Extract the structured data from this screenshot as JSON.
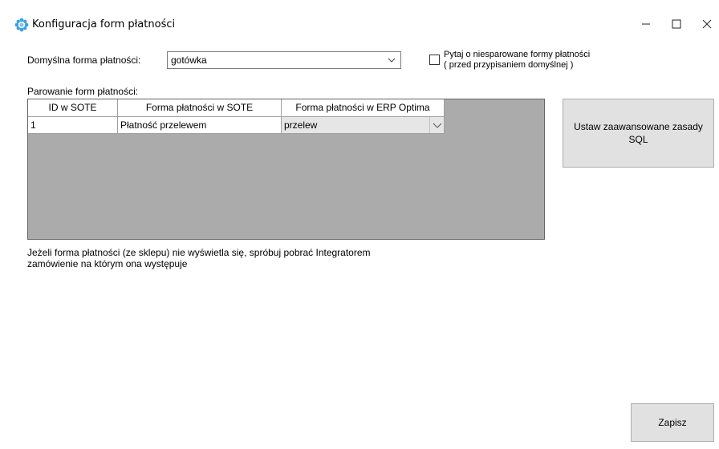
{
  "window": {
    "title": "Konfiguracja form płatności",
    "minimize_glyph": "—",
    "maximize_glyph": "☐",
    "close_glyph": "✕"
  },
  "default_payment": {
    "label": "Domyślna forma płatności:",
    "value": "gotówka"
  },
  "ask_unpaired": {
    "checked": false,
    "label_line1": "Pytaj o niesparowane formy płatności",
    "label_line2": "( przed przypisaniem domyślnej )"
  },
  "pairing": {
    "label": "Parowanie form płatności:",
    "columns": [
      "ID w SOTE",
      "Forma płatności w SOTE",
      "Forma płatności w ERP Optima"
    ],
    "rows": [
      {
        "id": "1",
        "sote": "Płatność przelewem",
        "erp": "przelew"
      }
    ]
  },
  "hint": "Jeżeli forma płatności (ze sklepu) nie wyświetla się, spróbuj pobrać Integratorem\nzamówienie na którym ona występuje",
  "buttons": {
    "sql": "Ustaw zaawansowane zasady SQL",
    "save": "Zapisz"
  },
  "icons": {
    "app": "gear-flower-icon",
    "dropdown": "chevron-down-icon"
  },
  "colors": {
    "grid_background": "#ababab",
    "button_face": "#e1e1e1",
    "app_icon": "#3aa0e0"
  }
}
